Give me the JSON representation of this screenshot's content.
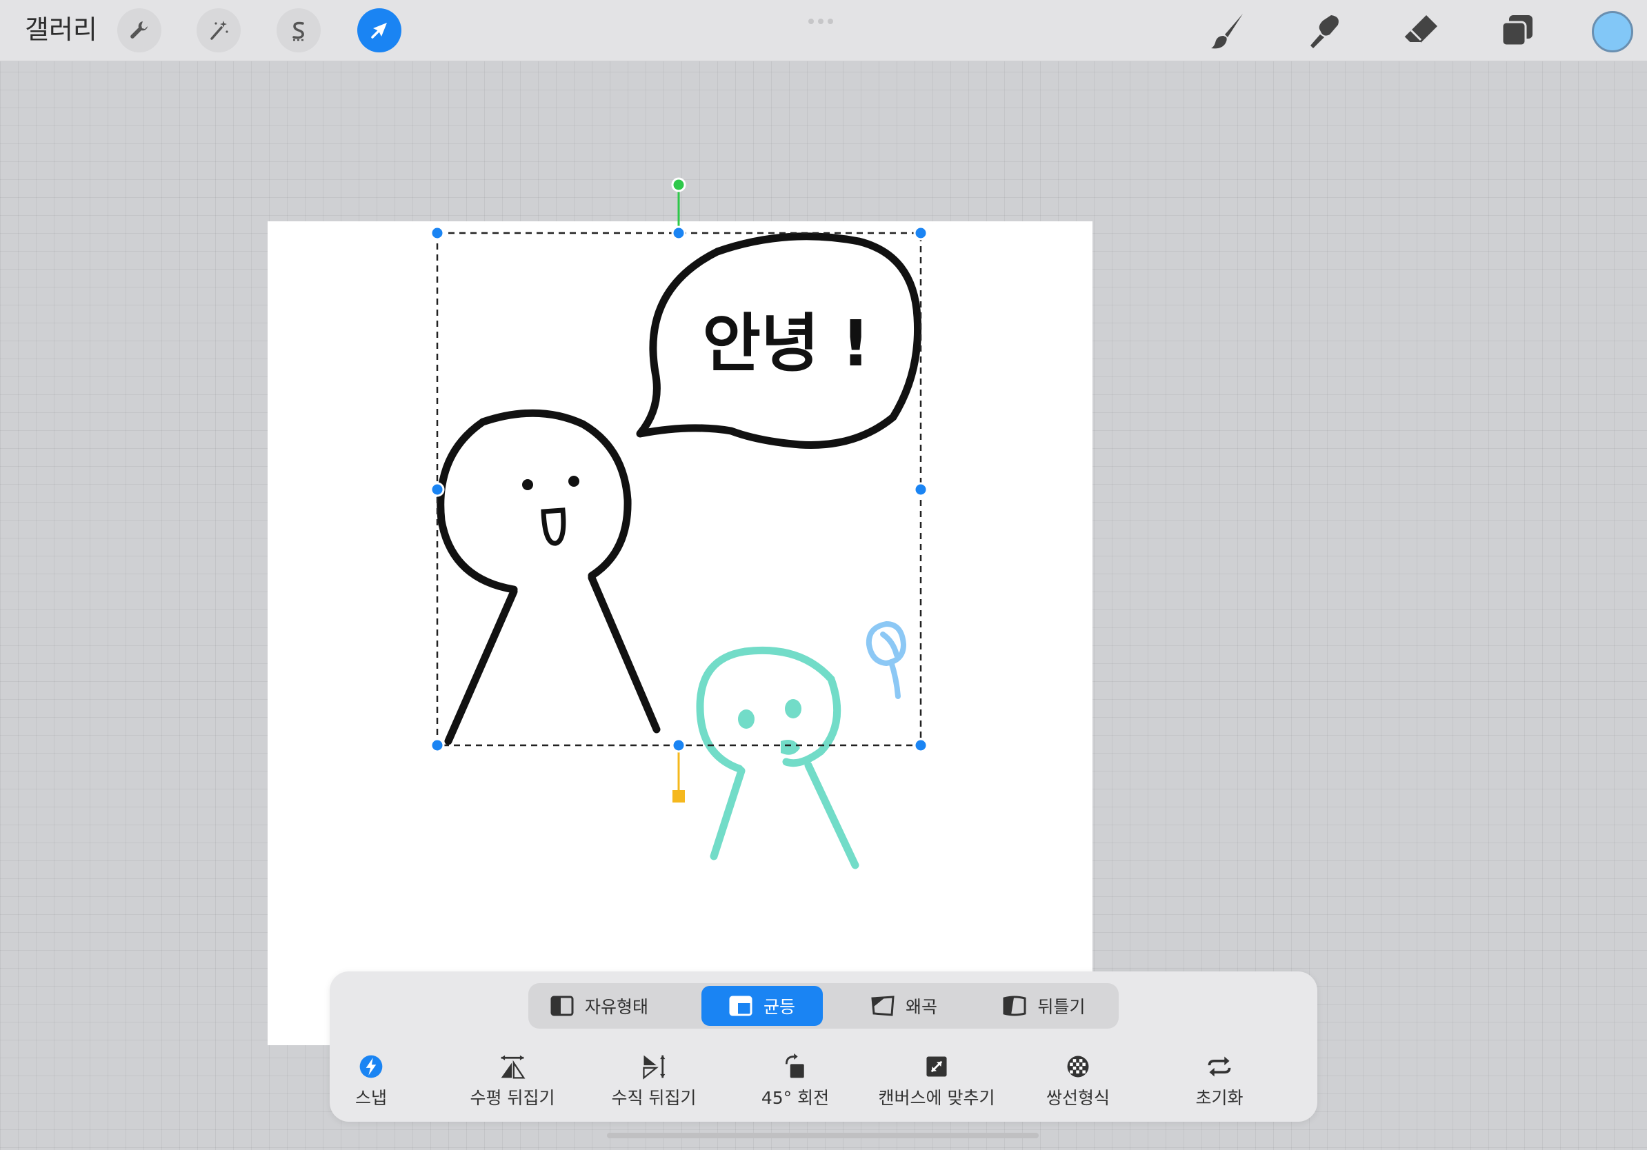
{
  "topbar": {
    "gallery_label": "갤러리",
    "left_tools": [
      "wrench-icon",
      "magic-wand-icon",
      "selection-s-icon",
      "transform-arrow-icon"
    ],
    "active_tool": "transform-arrow-icon",
    "right_tools": [
      "brush-icon",
      "smudge-icon",
      "eraser-icon",
      "layers-icon"
    ],
    "current_color": "#82c7f7"
  },
  "canvas": {
    "speech_text": "안녕 !"
  },
  "transform_panel": {
    "modes": [
      {
        "label": "자유형태",
        "active": false
      },
      {
        "label": "균등",
        "active": true
      },
      {
        "label": "왜곡",
        "active": false
      },
      {
        "label": "뒤틀기",
        "active": false
      }
    ],
    "actions": [
      {
        "label": "스냅",
        "icon": "snap-lightning-icon"
      },
      {
        "label": "수평 뒤집기",
        "icon": "flip-horizontal-icon"
      },
      {
        "label": "수직 뒤집기",
        "icon": "flip-vertical-icon"
      },
      {
        "label": "45° 회전",
        "icon": "rotate-45-icon"
      },
      {
        "label": "캔버스에 맞추기",
        "icon": "fit-to-canvas-icon"
      },
      {
        "label": "쌍선형식",
        "icon": "bilinear-icon"
      },
      {
        "label": "초기화",
        "icon": "reset-icon"
      }
    ]
  },
  "colors": {
    "accent": "#1a84f3",
    "selection_handle": "#1a84f3",
    "rotate_handle": "#2ec84a",
    "pivot_handle": "#f5b81e",
    "teal_figure": "#72dcc8",
    "blue_doodle": "#8cc8f5"
  }
}
